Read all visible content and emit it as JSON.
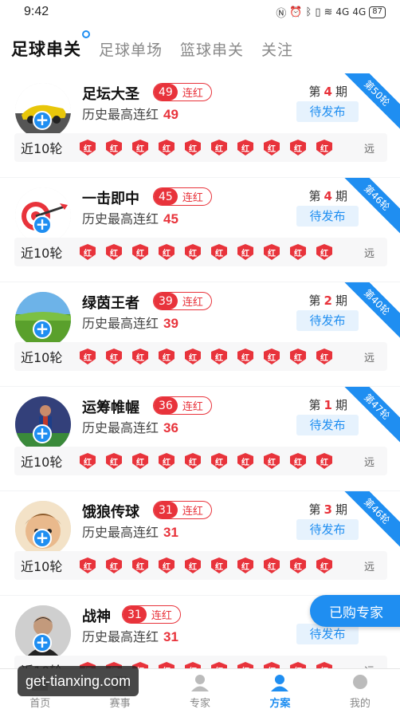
{
  "status_bar": {
    "time": "9:42",
    "signal_1": "4G",
    "signal_2": "4G",
    "battery": "87"
  },
  "tabs": [
    {
      "label": "足球串关",
      "active": true
    },
    {
      "label": "足球单场",
      "active": false
    },
    {
      "label": "篮球串关",
      "active": false
    },
    {
      "label": "关注",
      "active": false
    }
  ],
  "common": {
    "streak_label": "连红",
    "history_label": "历史最高连红",
    "period_prefix": "第",
    "period_suffix": "期",
    "pending_label": "待发布",
    "recent_label": "近10轮",
    "mark_label": "红",
    "far_label": "远",
    "follow_symbol": "+"
  },
  "experts": [
    {
      "name": "足坛大圣",
      "streak": "49",
      "history_max": "49",
      "period": "4",
      "ribbon": "第50轮",
      "avatar": "car-avatar"
    },
    {
      "name": "一击即中",
      "streak": "45",
      "history_max": "45",
      "period": "4",
      "ribbon": "第46轮",
      "avatar": "dart-avatar"
    },
    {
      "name": "绿茵王者",
      "streak": "39",
      "history_max": "39",
      "period": "2",
      "ribbon": "第40轮",
      "avatar": "grass-avatar"
    },
    {
      "name": "运筹帷幄",
      "streak": "36",
      "history_max": "36",
      "period": "1",
      "ribbon": "第47轮",
      "avatar": "player-avatar"
    },
    {
      "name": "饿狼传球",
      "streak": "31",
      "history_max": "31",
      "period": "3",
      "ribbon": "第46轮",
      "avatar": "cartoon-avatar"
    },
    {
      "name": "战神",
      "streak": "31",
      "history_max": "31",
      "period": "",
      "ribbon": "",
      "avatar": "man-avatar"
    }
  ],
  "float_button": "已购专家",
  "bottom_nav": [
    {
      "label": "首页",
      "icon": "home-icon",
      "active": false
    },
    {
      "label": "赛事",
      "icon": "match-icon",
      "active": false
    },
    {
      "label": "专家",
      "icon": "expert-icon",
      "active": false
    },
    {
      "label": "方案",
      "icon": "plan-icon",
      "active": true
    },
    {
      "label": "我的",
      "icon": "profile-icon",
      "active": false
    }
  ],
  "watermark": "get-tianxing.com",
  "colors": {
    "accent": "#1f8ef1",
    "red": "#e8333b"
  }
}
